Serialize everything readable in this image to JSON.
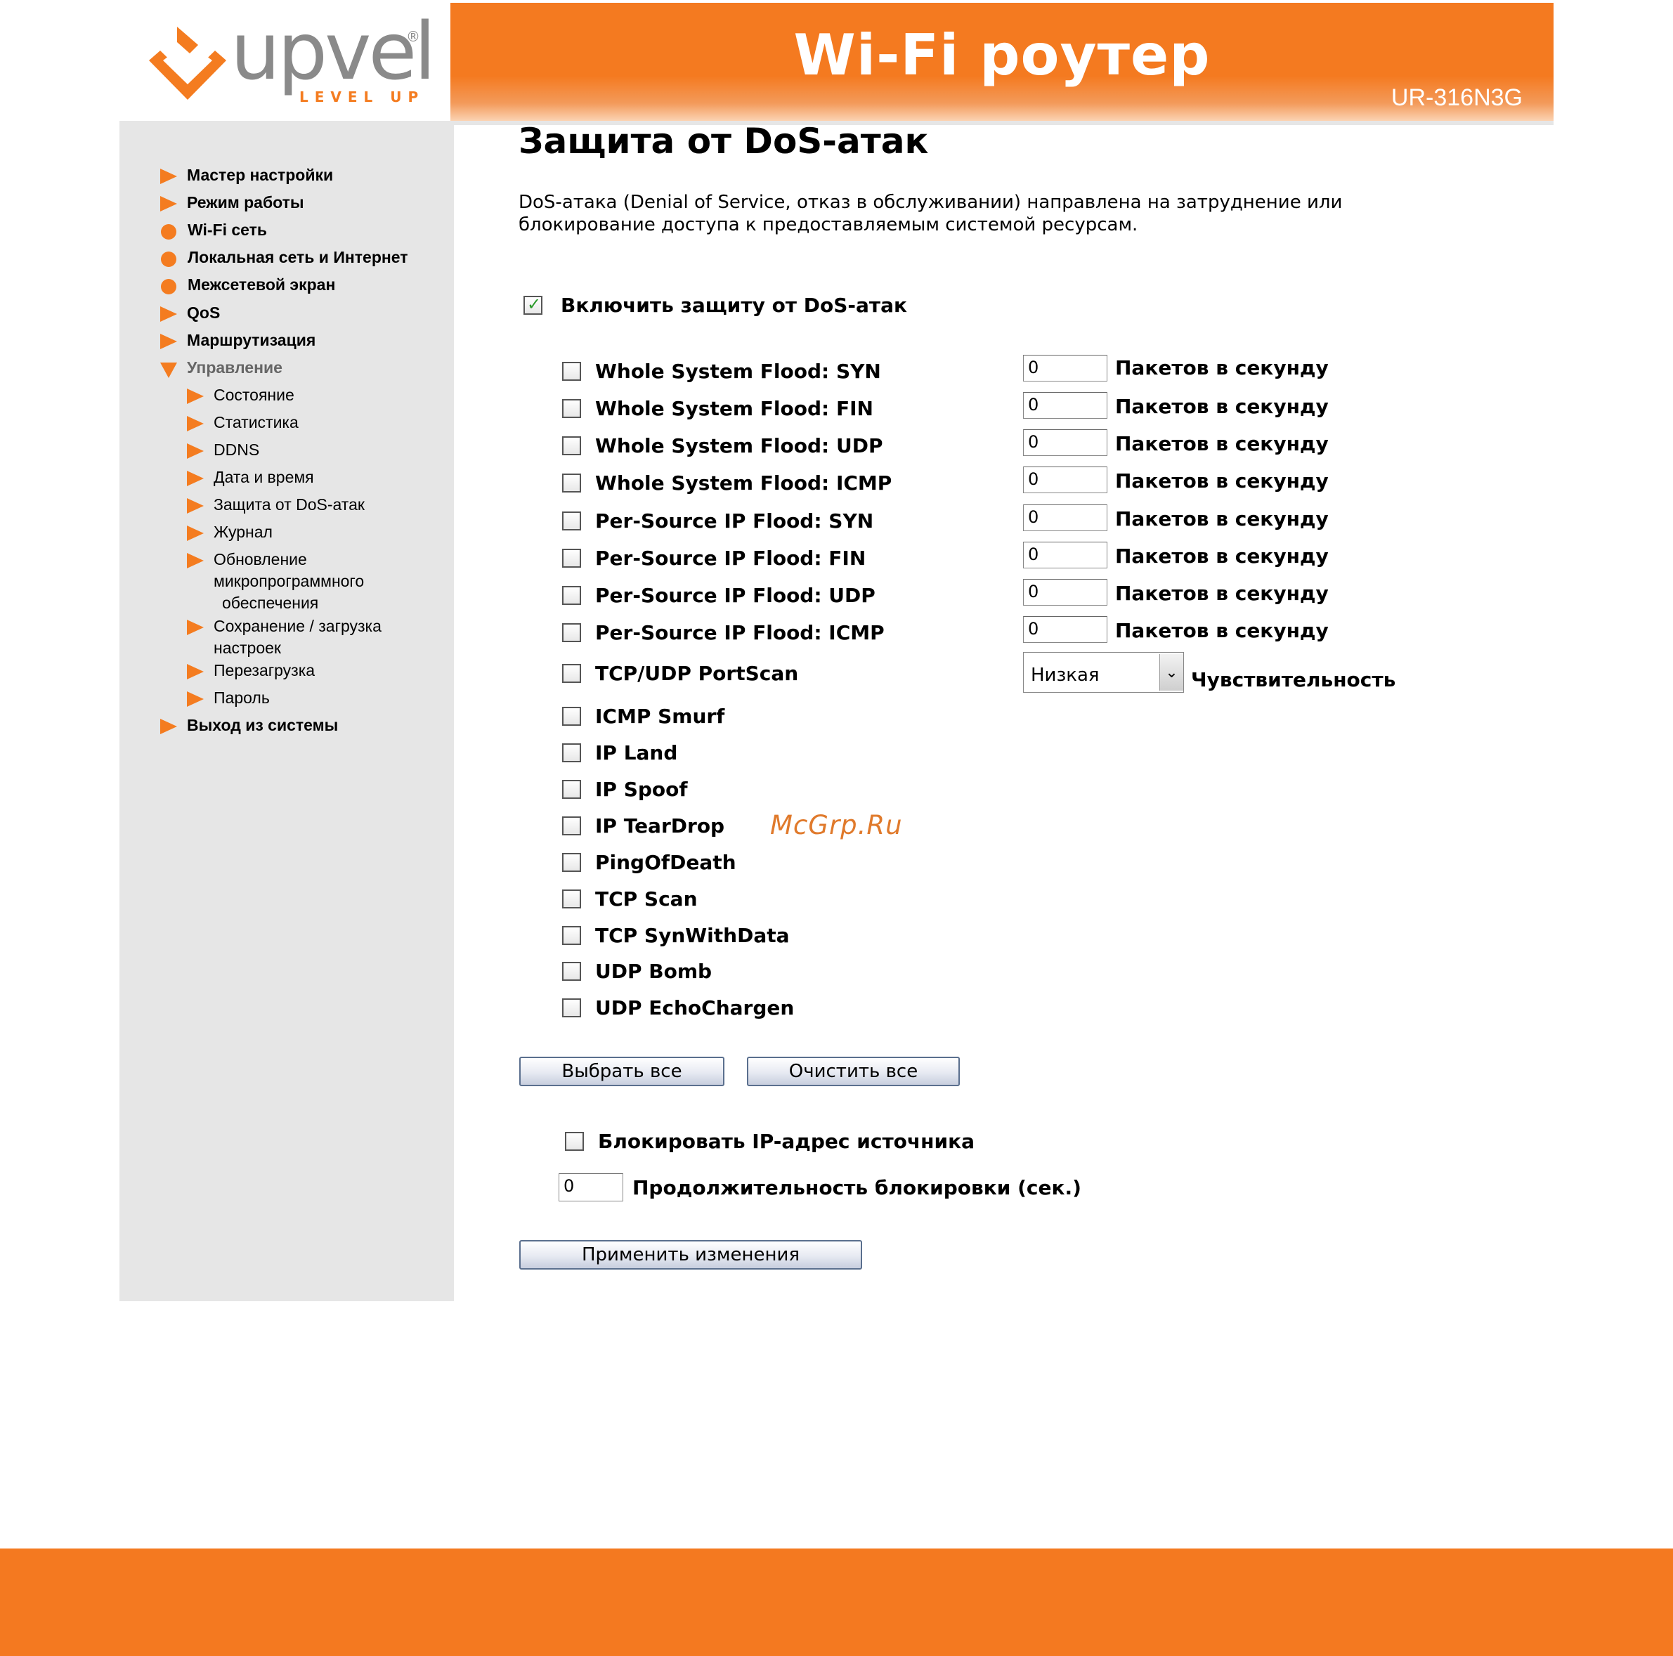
{
  "brand": {
    "logo_text": "upvel",
    "logo_sub": "LEVEL UP",
    "logo_reg": "®",
    "header_title": "Wi-Fi роутер",
    "model": "UR-316N3G",
    "accent_color": "#f47920"
  },
  "sidebar": {
    "items": [
      {
        "label": "Мастер настройки",
        "icon": "triangle-right-icon"
      },
      {
        "label": "Режим работы",
        "icon": "triangle-right-icon"
      },
      {
        "label": "Wi-Fi сеть",
        "icon": "circle-icon"
      },
      {
        "label": "Локальная сеть и Интернет",
        "icon": "circle-icon"
      },
      {
        "label": "Межсетевой экран",
        "icon": "circle-icon"
      },
      {
        "label": "QoS",
        "icon": "triangle-right-icon"
      },
      {
        "label": "Маршрутизация",
        "icon": "triangle-right-icon"
      },
      {
        "label": "Управление",
        "icon": "triangle-down-icon"
      },
      {
        "label": "Выход из системы",
        "icon": "triangle-right-icon"
      }
    ],
    "sub_items": [
      {
        "label": "Состояние"
      },
      {
        "label": "Статистика"
      },
      {
        "label": "DDNS"
      },
      {
        "label": "Дата и время"
      },
      {
        "label": "Защита от DoS-атак"
      },
      {
        "label": "Журнал"
      },
      {
        "label": "Обновление",
        "line2": "микропрограммного",
        "line3": "обеспечения"
      },
      {
        "label": "Сохранение / загрузка",
        "line2": "настроек"
      },
      {
        "label": "Перезагрузка"
      },
      {
        "label": "Пароль"
      }
    ]
  },
  "main": {
    "title": "Защита от DoS-атак",
    "description_line1": "DoS-атака (Denial of Service, отказ в обслуживании) направлена на затруднение или",
    "description_line2": "блокирование доступа к предоставляемым системой ресурсам.",
    "enable_label": "Включить защиту от DoS-атак",
    "enable_checked": true,
    "packets_unit": "Пакетов в секунду",
    "flood_options": [
      {
        "label": "Whole System Flood: SYN",
        "value": "0",
        "checked": false
      },
      {
        "label": "Whole System Flood: FIN",
        "value": "0",
        "checked": false
      },
      {
        "label": "Whole System Flood: UDP",
        "value": "0",
        "checked": false
      },
      {
        "label": "Whole System Flood: ICMP",
        "value": "0",
        "checked": false
      },
      {
        "label": "Per-Source IP Flood: SYN",
        "value": "0",
        "checked": false
      },
      {
        "label": "Per-Source IP Flood: FIN",
        "value": "0",
        "checked": false
      },
      {
        "label": "Per-Source IP Flood: UDP",
        "value": "0",
        "checked": false
      },
      {
        "label": "Per-Source IP Flood: ICMP",
        "value": "0",
        "checked": false
      }
    ],
    "portscan": {
      "label": "TCP/UDP PortScan",
      "checked": false,
      "sensitivity_value": "Низкая",
      "sensitivity_label": "Чувствительность"
    },
    "other_options": [
      {
        "label": "ICMP Smurf",
        "checked": false
      },
      {
        "label": "IP Land",
        "checked": false
      },
      {
        "label": "IP Spoof",
        "checked": false
      },
      {
        "label": "IP TearDrop",
        "checked": false
      },
      {
        "label": "PingOfDeath",
        "checked": false
      },
      {
        "label": "TCP Scan",
        "checked": false
      },
      {
        "label": "TCP SynWithData",
        "checked": false
      },
      {
        "label": "UDP Bomb",
        "checked": false
      },
      {
        "label": "UDP EchoChargen",
        "checked": false
      }
    ],
    "select_all_label": "Выбрать все",
    "clear_all_label": "Очистить все",
    "block_ip_label": "Блокировать IP-адрес источника",
    "block_ip_checked": false,
    "block_duration_value": "0",
    "block_duration_label": "Продолжительность блокировки (сек.)",
    "apply_label": "Применить изменения"
  },
  "watermark": "McGrp.Ru"
}
